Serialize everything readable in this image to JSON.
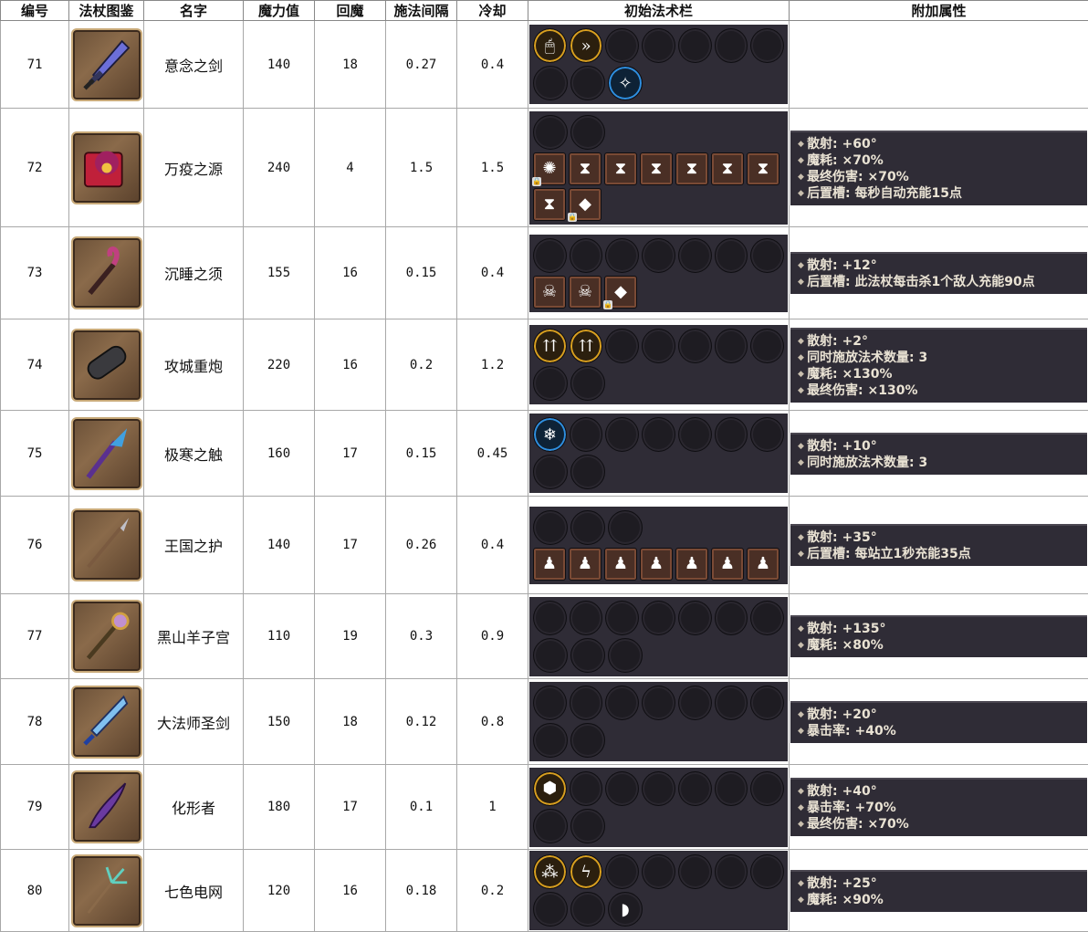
{
  "headers": [
    "编号",
    "法杖图鉴",
    "名字",
    "魔力值",
    "回魔",
    "施法间隔",
    "冷却",
    "初始法术栏",
    "附加属性"
  ],
  "rows": [
    {
      "id": "71",
      "name": "意念之剑",
      "mana": "140",
      "regen": "18",
      "interval": "0.27",
      "cooldown": "0.4",
      "wand_icon": "crystal-sword-icon",
      "slots": [
        [
          {
            "t": "gold",
            "icon": "mouse-icon",
            "g": "🖱"
          },
          {
            "t": "gold",
            "icon": "double-chevron-icon",
            "g": "»"
          },
          {
            "t": "empty"
          },
          {
            "t": "empty"
          },
          {
            "t": "empty"
          },
          {
            "t": "empty"
          },
          {
            "t": "empty"
          }
        ],
        [
          {
            "t": "empty"
          },
          {
            "t": "empty"
          },
          {
            "t": "blue",
            "icon": "teleport-icon",
            "g": "✧"
          }
        ]
      ],
      "attrs": []
    },
    {
      "id": "72",
      "name": "万疫之源",
      "mana": "240",
      "regen": "4",
      "interval": "1.5",
      "cooldown": "1.5",
      "wand_icon": "plague-tome-icon",
      "slots": [
        [
          {
            "t": "empty"
          },
          {
            "t": "empty"
          }
        ],
        [
          {
            "t": "gold-sq",
            "icon": "spiral-icon",
            "g": "✺",
            "lock": true
          },
          {
            "t": "square",
            "icon": "hourglass-icon",
            "g": "⧗"
          },
          {
            "t": "square",
            "icon": "hourglass-icon",
            "g": "⧗"
          },
          {
            "t": "square",
            "icon": "hourglass-icon",
            "g": "⧗"
          },
          {
            "t": "square",
            "icon": "hourglass-icon",
            "g": "⧗"
          },
          {
            "t": "square",
            "icon": "hourglass-icon",
            "g": "⧗"
          },
          {
            "t": "square",
            "icon": "hourglass-icon",
            "g": "⧗"
          }
        ],
        [
          {
            "t": "square",
            "icon": "hourglass-icon",
            "g": "⧗"
          },
          {
            "t": "blue-sq",
            "icon": "pink-crystal-icon",
            "g": "◆",
            "lock": true
          }
        ]
      ],
      "attrs": [
        "散射: +60°",
        "魔耗: ×70%",
        "最终伤害: ×70%",
        "后置槽: 每秒自动充能15点"
      ]
    },
    {
      "id": "73",
      "name": "沉睡之须",
      "mana": "155",
      "regen": "16",
      "interval": "0.15",
      "cooldown": "0.4",
      "wand_icon": "tentacle-staff-icon",
      "slots": [
        [
          {
            "t": "empty"
          },
          {
            "t": "empty"
          },
          {
            "t": "empty"
          },
          {
            "t": "empty"
          },
          {
            "t": "empty"
          },
          {
            "t": "empty"
          },
          {
            "t": "empty"
          }
        ],
        [
          {
            "t": "square",
            "icon": "skull-icon",
            "g": "☠"
          },
          {
            "t": "square",
            "icon": "skull-icon",
            "g": "☠"
          },
          {
            "t": "blue-sq",
            "icon": "pink-crystal-icon",
            "g": "◆",
            "lock": true
          }
        ]
      ],
      "attrs": [
        "散射: +12°",
        "后置槽: 此法杖每击杀1个敌人充能90点"
      ]
    },
    {
      "id": "74",
      "name": "攻城重炮",
      "mana": "220",
      "regen": "16",
      "interval": "0.2",
      "cooldown": "1.2",
      "wand_icon": "cannon-icon",
      "slots": [
        [
          {
            "t": "gold",
            "icon": "arrows-up-icon",
            "g": "⇈"
          },
          {
            "t": "gold",
            "icon": "arrows-up-icon",
            "g": "⇈"
          },
          {
            "t": "empty"
          },
          {
            "t": "empty"
          },
          {
            "t": "empty"
          },
          {
            "t": "empty"
          },
          {
            "t": "empty"
          }
        ],
        [
          {
            "t": "empty"
          },
          {
            "t": "empty"
          }
        ]
      ],
      "attrs": [
        "散射: +2°",
        "同时施放法术数量: 3",
        "魔耗: ×130%",
        "最终伤害: ×130%"
      ]
    },
    {
      "id": "75",
      "name": "极寒之触",
      "mana": "160",
      "regen": "17",
      "interval": "0.15",
      "cooldown": "0.45",
      "wand_icon": "frost-staff-icon",
      "slots": [
        [
          {
            "t": "blue",
            "icon": "ice-icon",
            "g": "❄"
          },
          {
            "t": "empty"
          },
          {
            "t": "empty"
          },
          {
            "t": "empty"
          },
          {
            "t": "empty"
          },
          {
            "t": "empty"
          },
          {
            "t": "empty"
          }
        ],
        [
          {
            "t": "empty"
          },
          {
            "t": "empty"
          }
        ]
      ],
      "attrs": [
        "散射: +10°",
        "同时施放法术数量: 3"
      ]
    },
    {
      "id": "76",
      "name": "王国之护",
      "mana": "140",
      "regen": "17",
      "interval": "0.26",
      "cooldown": "0.4",
      "wand_icon": "spear-icon",
      "slots": [
        [
          {
            "t": "empty"
          },
          {
            "t": "empty"
          },
          {
            "t": "empty"
          }
        ],
        [
          {
            "t": "square",
            "icon": "statue-icon",
            "g": "♟"
          },
          {
            "t": "square",
            "icon": "statue-icon",
            "g": "♟"
          },
          {
            "t": "square",
            "icon": "statue-icon",
            "g": "♟"
          },
          {
            "t": "square",
            "icon": "statue-icon",
            "g": "♟"
          },
          {
            "t": "square",
            "icon": "statue-icon",
            "g": "♟"
          },
          {
            "t": "square",
            "icon": "statue-icon",
            "g": "♟"
          },
          {
            "t": "square",
            "icon": "statue-icon",
            "g": "♟"
          }
        ]
      ],
      "attrs": [
        "散射: +35°",
        "后置槽: 每站立1秒充能35点"
      ]
    },
    {
      "id": "77",
      "name": "黑山羊子宫",
      "mana": "110",
      "regen": "19",
      "interval": "0.3",
      "cooldown": "0.9",
      "wand_icon": "eye-scepter-icon",
      "slots": [
        [
          {
            "t": "empty"
          },
          {
            "t": "empty"
          },
          {
            "t": "empty"
          },
          {
            "t": "empty"
          },
          {
            "t": "empty"
          },
          {
            "t": "empty"
          },
          {
            "t": "empty"
          }
        ],
        [
          {
            "t": "empty"
          },
          {
            "t": "empty"
          },
          {
            "t": "empty"
          }
        ]
      ],
      "attrs": [
        "散射: +135°",
        "魔耗: ×80%"
      ]
    },
    {
      "id": "78",
      "name": "大法师圣剑",
      "mana": "150",
      "regen": "18",
      "interval": "0.12",
      "cooldown": "0.8",
      "wand_icon": "ice-blade-icon",
      "slots": [
        [
          {
            "t": "empty"
          },
          {
            "t": "empty"
          },
          {
            "t": "empty"
          },
          {
            "t": "empty"
          },
          {
            "t": "empty"
          },
          {
            "t": "empty"
          },
          {
            "t": "empty"
          }
        ],
        [
          {
            "t": "empty"
          },
          {
            "t": "empty"
          }
        ]
      ],
      "attrs": [
        "散射: +20°",
        "暴击率: +40%"
      ]
    },
    {
      "id": "79",
      "name": "化形者",
      "mana": "180",
      "regen": "17",
      "interval": "0.1",
      "cooldown": "1",
      "wand_icon": "shadow-blade-icon",
      "slots": [
        [
          {
            "t": "gold",
            "icon": "cube-icon",
            "g": "⬢"
          },
          {
            "t": "empty"
          },
          {
            "t": "empty"
          },
          {
            "t": "empty"
          },
          {
            "t": "empty"
          },
          {
            "t": "empty"
          },
          {
            "t": "empty"
          }
        ],
        [
          {
            "t": "empty"
          },
          {
            "t": "empty"
          }
        ]
      ],
      "attrs": [
        "散射: +40°",
        "暴击率: +70%",
        "最终伤害: ×70%"
      ]
    },
    {
      "id": "80",
      "name": "七色电网",
      "mana": "120",
      "regen": "16",
      "interval": "0.18",
      "cooldown": "0.2",
      "wand_icon": "branch-staff-icon",
      "slots": [
        [
          {
            "t": "gold",
            "icon": "triple-orb-icon",
            "g": "⁂"
          },
          {
            "t": "gold",
            "icon": "lightning-icon",
            "g": "ϟ"
          },
          {
            "t": "empty"
          },
          {
            "t": "empty"
          },
          {
            "t": "empty"
          },
          {
            "t": "empty"
          },
          {
            "t": "empty"
          }
        ],
        [
          {
            "t": "empty"
          },
          {
            "t": "empty"
          },
          {
            "t": "empty",
            "icon": "rainbow-icon",
            "g": "◗"
          }
        ]
      ],
      "attrs": [
        "散射: +25°",
        "魔耗: ×90%"
      ]
    }
  ]
}
